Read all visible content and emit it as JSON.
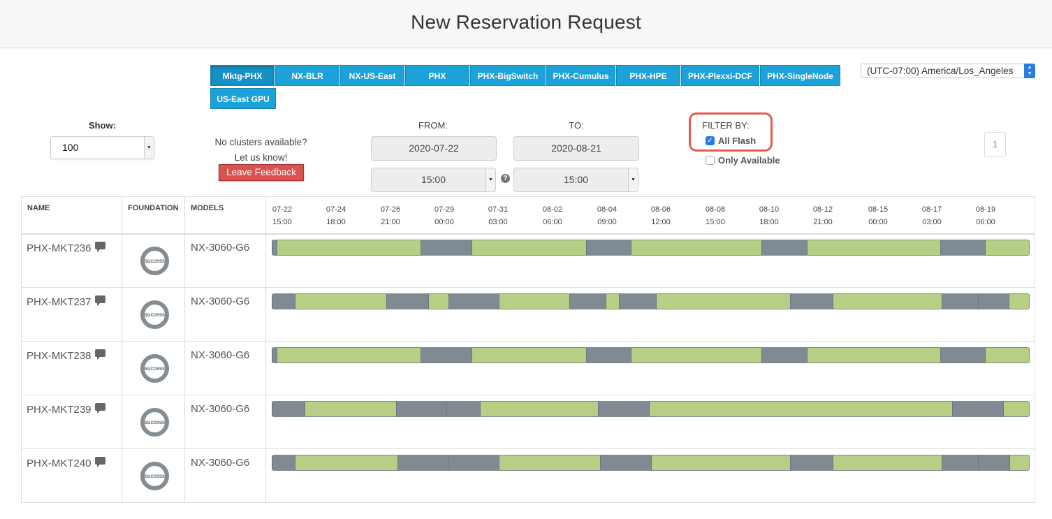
{
  "header": {
    "title": "New Reservation Request"
  },
  "tabs": [
    "Mktg-PHX",
    "NX-BLR",
    "NX-US-East",
    "PHX",
    "PHX-BigSwitch",
    "PHX-Cumulus",
    "PHX-HPE",
    "PHX-Plexxi-DCF",
    "PHX-SingleNode",
    "US-East GPU"
  ],
  "active_tab": "Mktg-PHX",
  "timezone": "(UTC-07:00) America/Los_Angeles",
  "show": {
    "label": "Show:",
    "value": "100"
  },
  "feedback": {
    "line1": "No clusters available?",
    "line2": "Let us know!",
    "button": "Leave Feedback"
  },
  "from": {
    "label": "FROM:",
    "date": "2020-07-22",
    "time": "15:00"
  },
  "to": {
    "label": "TO:",
    "date": "2020-08-21",
    "time": "15:00"
  },
  "filter": {
    "label": "FILTER BY:",
    "all_flash": "All Flash",
    "all_flash_checked": true,
    "only_available": "Only Available",
    "only_available_checked": false
  },
  "pagination": {
    "page": "1"
  },
  "table": {
    "columns": {
      "name": "NAME",
      "foundation": "FOUNDATION",
      "models": "MODELS"
    },
    "ticks": [
      {
        "date": "07-22",
        "time": "15:00"
      },
      {
        "date": "07-24",
        "time": "18:00"
      },
      {
        "date": "07-26",
        "time": "21:00"
      },
      {
        "date": "07-29",
        "time": "00:00"
      },
      {
        "date": "07-31",
        "time": "03:00"
      },
      {
        "date": "08-02",
        "time": "06:00"
      },
      {
        "date": "08-04",
        "time": "09:00"
      },
      {
        "date": "08-06",
        "time": "12:00"
      },
      {
        "date": "08-08",
        "time": "15:00"
      },
      {
        "date": "08-10",
        "time": "18:00"
      },
      {
        "date": "08-12",
        "time": "21:00"
      },
      {
        "date": "08-15",
        "time": "00:00"
      },
      {
        "date": "08-17",
        "time": "03:00"
      },
      {
        "date": "08-19",
        "time": "06:00"
      }
    ],
    "rows": [
      {
        "name": "PHX-MKT236",
        "status": "success",
        "model": "NX-3060-G6"
      },
      {
        "name": "PHX-MKT237",
        "status": "success",
        "model": "NX-3060-G6"
      },
      {
        "name": "PHX-MKT238",
        "status": "success",
        "model": "NX-3060-G6"
      },
      {
        "name": "PHX-MKT239",
        "status": "success",
        "model": "NX-3060-G6"
      },
      {
        "name": "PHX-MKT240",
        "status": "success",
        "model": "NX-3060-G6"
      }
    ]
  },
  "colors": {
    "accent": "#1ca2d9",
    "available": "#b7cf84",
    "reserved": "#7f8a93",
    "danger": "#d9534f"
  }
}
